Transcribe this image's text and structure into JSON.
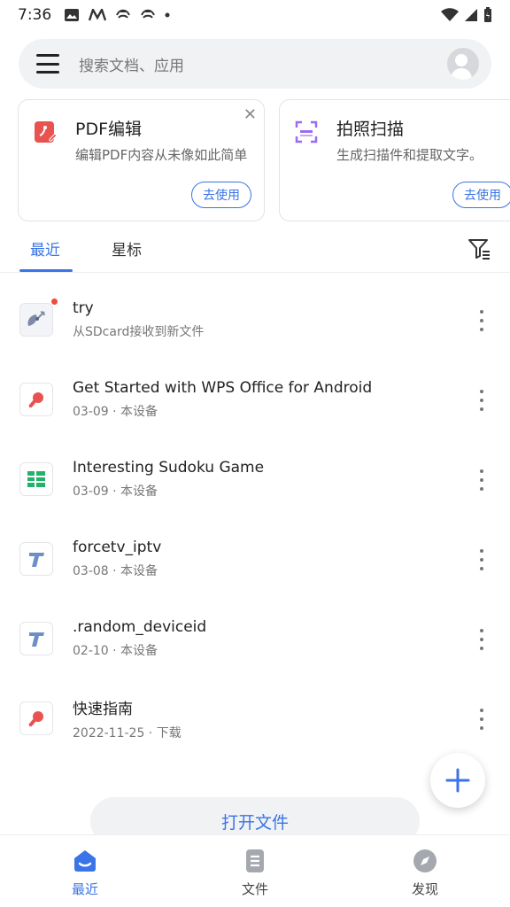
{
  "status_bar": {
    "time": "7:36",
    "icons": [
      "image-icon",
      "m-icon",
      "fan-icon",
      "fan-icon",
      "dot-icon",
      "wifi-icon",
      "signal-icon",
      "battery-icon"
    ]
  },
  "search": {
    "placeholder": "搜索文档、应用"
  },
  "cards": [
    {
      "title": "PDF编辑",
      "desc": "编辑PDF内容从未像如此简单",
      "button": "去使用",
      "icon": "pdf-edit-icon"
    },
    {
      "title": "拍照扫描",
      "desc": "生成扫描件和提取文字。",
      "button": "去使用",
      "icon": "scan-icon"
    }
  ],
  "tabs": {
    "recent": "最近",
    "starred": "星标"
  },
  "files": [
    {
      "name": "try",
      "meta": "从SDcard接收到新文件",
      "icon": "satellite-icon"
    },
    {
      "name": "Get Started with WPS Office for Android",
      "meta": "03-09 · 本设备",
      "icon": "pdf-icon"
    },
    {
      "name": "Interesting Sudoku Game",
      "meta": "03-09 · 本设备",
      "icon": "spreadsheet-icon"
    },
    {
      "name": "forcetv_iptv",
      "meta": "03-08 · 本设备",
      "icon": "text-icon"
    },
    {
      "name": ".random_deviceid",
      "meta": "02-10 · 本设备",
      "icon": "text-icon"
    },
    {
      "name": "快速指南",
      "meta": "2022-11-25 · 下载",
      "icon": "pdf-icon"
    }
  ],
  "open_file": "打开文件",
  "nav": {
    "recent": "最近",
    "files": "文件",
    "discover": "发现"
  },
  "colors": {
    "accent": "#3a74e6",
    "pdf": "#e8524f",
    "sheet": "#22b36b",
    "text_doc": "#6d8fc7"
  }
}
